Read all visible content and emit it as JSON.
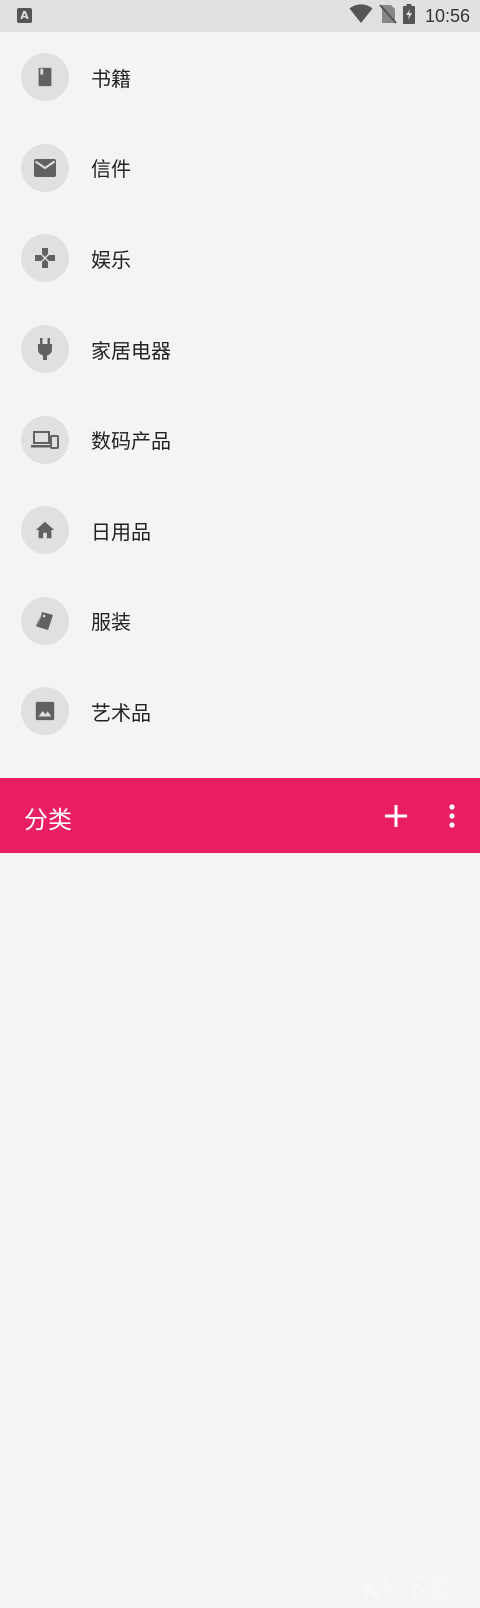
{
  "status_bar": {
    "notification_icon": "app-a-icon",
    "time": "10:56"
  },
  "categories": [
    {
      "label": "书籍",
      "icon": "book-icon"
    },
    {
      "label": "信件",
      "icon": "mail-icon"
    },
    {
      "label": "娱乐",
      "icon": "gamepad-icon"
    },
    {
      "label": "家居电器",
      "icon": "plug-icon"
    },
    {
      "label": "数码产品",
      "icon": "devices-icon"
    },
    {
      "label": "日用品",
      "icon": "home-icon"
    },
    {
      "label": "服装",
      "icon": "style-tag-icon"
    },
    {
      "label": "艺术品",
      "icon": "image-icon"
    }
  ],
  "bottom_bar": {
    "title": "分类",
    "add_icon": "add-icon",
    "more_icon": "more-vert-icon",
    "watermark": "Kk下载"
  },
  "colors": {
    "accent": "#e91e63",
    "icon_gray": "#616161",
    "circle_bg": "#e0e0e0",
    "page_bg": "#f4f4f4"
  }
}
